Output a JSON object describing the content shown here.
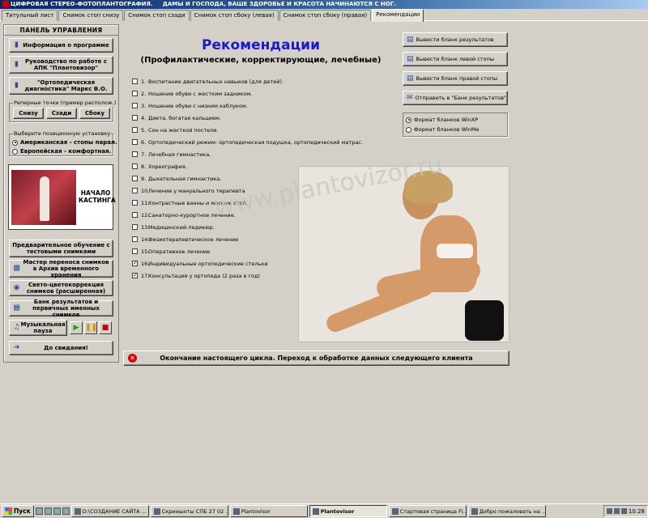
{
  "titlebar": {
    "title": "ЦИФРОВАЯ СТЕРЕО-ФОТОПЛАНТОГРАФИЯ.",
    "slogan": "ДАМЫ И ГОСПОДА, ВАШЕ ЗДОРОВЬЕ И КРАСОТА НАЧИНАЮТСЯ С НОГ."
  },
  "tabs": [
    {
      "label": "Титульный лист"
    },
    {
      "label": "Снимок стоп снизу"
    },
    {
      "label": "Снимок стоп сзади"
    },
    {
      "label": "Снимок стоп сбоку (левая)"
    },
    {
      "label": "Снимок стоп сбоку (правая)"
    },
    {
      "label": "Рекомендации",
      "active": true
    }
  ],
  "panel": {
    "title": "ПАНЕЛЬ УПРАВЛЕНИЯ",
    "info_button": "Информация о программе",
    "guide_button": "Руководство по работе с АПК \"Плантовизор\"",
    "marks_button": "\"Ортопедическая диагностика\" Маркс В.О.",
    "ref_points_label": "Реперные точки (пример располож.)",
    "ref_buttons": [
      "Снизу",
      "Сзади",
      "Сбоку"
    ],
    "position_label": "Выберите позиционную установку",
    "position_options": [
      {
        "label": "Американская - стопы парал.",
        "selected": true
      },
      {
        "label": "Европейская - комфортная.",
        "selected": false
      }
    ],
    "casting_text": "НАЧАЛО КАСТИНГА",
    "training_button": "Предварительное обучение с тестовыми снимками",
    "transfer_button": "Мастер переноса снимков в Архив временного хранения",
    "color_button": "Свето-цветокоррекция снимков (расширенная)",
    "bank_button": "Банк результатов и первичных именных снимков",
    "music_button": "Музыкальная пауза",
    "goodbye_button": "До свидания!"
  },
  "main": {
    "title": "Рекомендации",
    "subtitle": "(Профилактические, корректирующие, лечебные)",
    "items": [
      {
        "num": "1.",
        "text": "Воспитание двигательных навыков (для детей).",
        "checked": false
      },
      {
        "num": "2.",
        "text": "Ношение обуви с жестким задником.",
        "checked": false
      },
      {
        "num": "3.",
        "text": "Ношение обуви с низким каблуком.",
        "checked": false
      },
      {
        "num": "4.",
        "text": "Диета, богатая кальцием.",
        "checked": false
      },
      {
        "num": "5.",
        "text": "Сон на жесткой постели.",
        "checked": false
      },
      {
        "num": "6.",
        "text": "Ортопедический режим: ортопедическая подушка, ортопедический матрас.",
        "checked": false
      },
      {
        "num": "7.",
        "text": "Лечебная гимнастика.",
        "checked": false
      },
      {
        "num": "8.",
        "text": "Хореография.",
        "checked": false
      },
      {
        "num": "9.",
        "text": "Дыхательная гимнастика.",
        "checked": false
      },
      {
        "num": "10.",
        "text": "Лечение у мануального терапевта",
        "checked": false
      },
      {
        "num": "11.",
        "text": "Контрастные ванны и массаж стоп.",
        "checked": false
      },
      {
        "num": "12.",
        "text": "Санаторно-курортное лечение.",
        "checked": false
      },
      {
        "num": "13.",
        "text": "Медицинский педикюр.",
        "checked": false
      },
      {
        "num": "14.",
        "text": "Физиотерапевтическое лечение",
        "checked": false
      },
      {
        "num": "15.",
        "text": "Оперативное лечение",
        "checked": false
      },
      {
        "num": "16.",
        "text": "Индивидуальные ортопедические стельки",
        "checked": true
      },
      {
        "num": "17.",
        "text": "Консультация у ортопеда (2 раза в год)",
        "checked": true
      }
    ],
    "watermark": "www.plantovizor.ru"
  },
  "actions": {
    "buttons": [
      "Вывести бланк результатов",
      "Вывести бланк левой стопы",
      "Вывести бланк правой стопы",
      "Отправить в \"Банк результатов\""
    ],
    "format_options": [
      {
        "label": "Формат бланков WinXP",
        "selected": true
      },
      {
        "label": "Формат бланков WinMe",
        "selected": false
      }
    ]
  },
  "end_bar": {
    "text": "Окончание настоящего цикла. Переход к обработке данных следующего клиента"
  },
  "taskbar": {
    "start": "Пуск",
    "tasks": [
      {
        "label": "D:\\СОЗДАНИЕ САЙТА ...",
        "active": false
      },
      {
        "label": "Скриншоты СПБ 27 02 ...",
        "active": false
      },
      {
        "label": "Plantovisor",
        "active": false
      },
      {
        "label": "Plantovisor",
        "active": true
      },
      {
        "label": "Стартовая страница Fi...",
        "active": false
      },
      {
        "label": "Добро пожаловать на ...",
        "active": false
      }
    ],
    "clock": "10:28"
  }
}
